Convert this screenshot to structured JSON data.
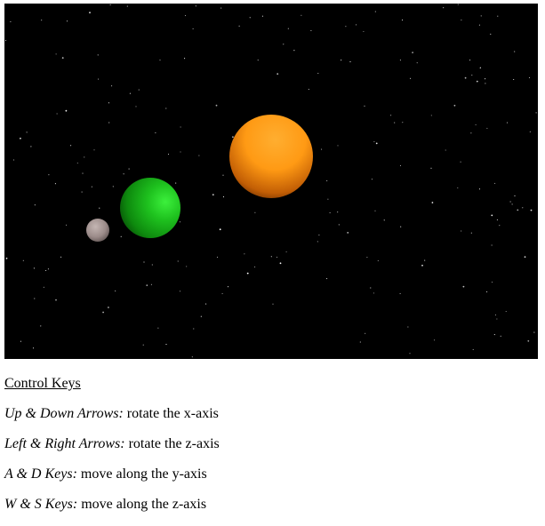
{
  "scene": {
    "background_color": "#000000",
    "planets": [
      {
        "name": "moon",
        "color": "#b3a3a0",
        "glow": "#7a6c6a"
      },
      {
        "name": "green-planet",
        "color": "#1ec11e",
        "glow": "#0a5a0a"
      },
      {
        "name": "orange-planet",
        "color": "#ff9a14",
        "glow": "#8a4200"
      }
    ]
  },
  "controls": {
    "heading": "Control Keys",
    "items": [
      {
        "key": "Up & Down Arrows:",
        "action": " rotate the x-axis"
      },
      {
        "key": "Left & Right Arrows:",
        "action": " rotate the z-axis"
      },
      {
        "key": "A & D Keys:",
        "action": " move along the y-axis"
      },
      {
        "key": "W & S Keys:",
        "action": " move along the z-axis"
      }
    ]
  }
}
